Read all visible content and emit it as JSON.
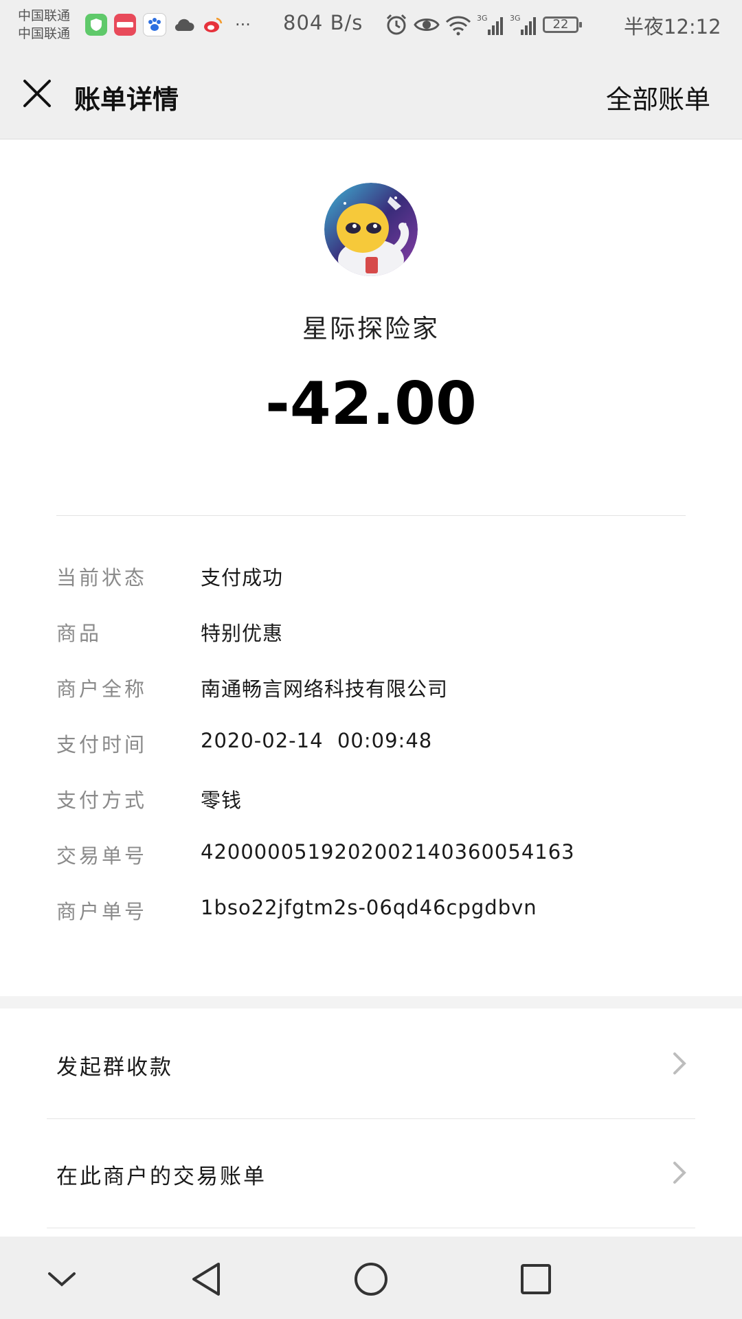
{
  "status_bar": {
    "carrier_1": "中国联通",
    "carrier_2": "中国联通",
    "net_speed": "804 B/s",
    "battery": "22",
    "time": "半夜12:12",
    "more": "···",
    "apps": [
      "shield-app",
      "xiaohongshu-app",
      "baidu-app",
      "cloud-app",
      "weibo-app"
    ]
  },
  "header": {
    "title": "账单详情",
    "all_bills": "全部账单"
  },
  "merchant": {
    "name": "星际探险家",
    "amount": "-42.00",
    "avatar_icon": "alien-astronaut-icon"
  },
  "details": [
    {
      "label": "当前状态",
      "value": "支付成功"
    },
    {
      "label": "商品",
      "value": "特别优惠"
    },
    {
      "label": "商户全称",
      "value": "南通畅言网络科技有限公司"
    },
    {
      "label": "支付时间",
      "value": "2020-02-14  00:09:48"
    },
    {
      "label": "支付方式",
      "value": "零钱"
    },
    {
      "label": "交易单号",
      "value": "4200000519202002140360054163"
    },
    {
      "label": "商户单号",
      "value": "1bso22jfgtm2s-06qd46cpgdbvn"
    }
  ],
  "actions": [
    {
      "label": "发起群收款"
    },
    {
      "label": "在此商户的交易账单"
    }
  ],
  "colors": {
    "bar_bg": "#efefef",
    "label_gray": "#8a8a8a",
    "text": "#1a1a1a"
  }
}
